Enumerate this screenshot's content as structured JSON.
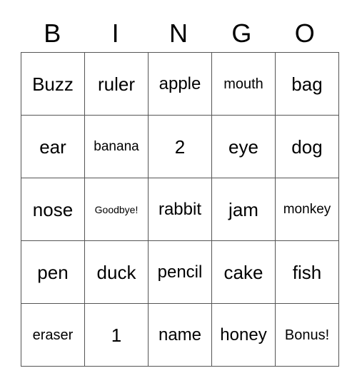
{
  "header": {
    "letters": [
      "B",
      "I",
      "N",
      "G",
      "O"
    ]
  },
  "grid": {
    "rows": [
      [
        "Buzz",
        "ruler",
        "apple",
        "mouth",
        "bag"
      ],
      [
        "ear",
        "banana",
        "2",
        "eye",
        "dog"
      ],
      [
        "nose",
        "Goodbye!",
        "rabbit",
        "jam",
        "monkey"
      ],
      [
        "pen",
        "duck",
        "pencil",
        "cake",
        "fish"
      ],
      [
        "eraser",
        "1",
        "name",
        "honey",
        "Bonus!"
      ]
    ]
  }
}
